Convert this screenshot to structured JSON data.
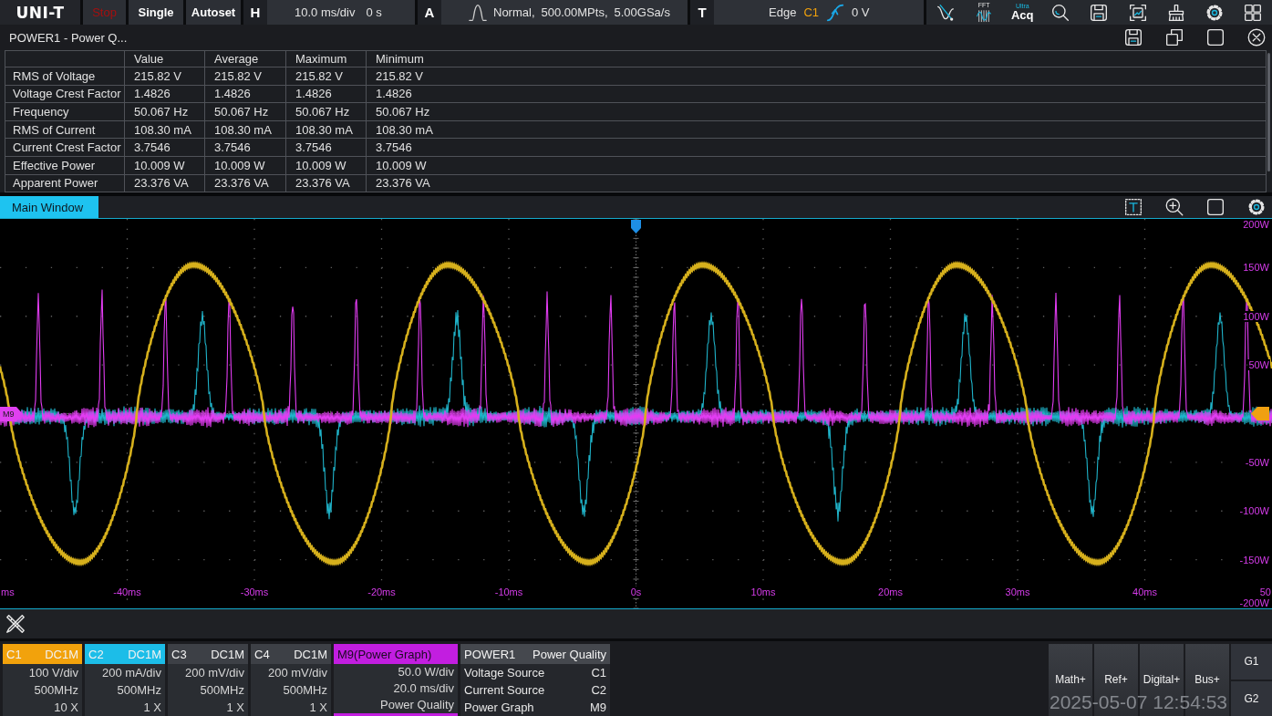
{
  "toolbar": {
    "logo": "UNI-T",
    "buttons": [
      {
        "label": "Stop",
        "kind": "run"
      },
      {
        "label": "Single",
        "kind": "action"
      },
      {
        "label": "Autoset",
        "kind": "action"
      }
    ],
    "horizontal": {
      "tag": "H",
      "scale": "10.0 ms/div",
      "offset": "0 s"
    },
    "acquisition": {
      "tag": "A",
      "mode": "Normal,",
      "depth": "500.00MPts,",
      "rate": "5.00GSa/s"
    },
    "trigger": {
      "tag": "T",
      "type": "Edge",
      "source": "C1",
      "level": "0 V"
    },
    "tools": [
      {
        "kind": "math"
      },
      {
        "kind": "fft",
        "badge": "FFT"
      },
      {
        "kind": "acq",
        "label": "Acq",
        "badge": "Ultra"
      },
      {
        "kind": "search"
      },
      {
        "kind": "save"
      },
      {
        "kind": "screenshot"
      },
      {
        "kind": "clear"
      },
      {
        "kind": "settings"
      },
      {
        "kind": "windows"
      }
    ]
  },
  "measure_window": {
    "title": "POWER1 - Power Q...",
    "tools": [
      {
        "kind": "save"
      },
      {
        "kind": "float"
      },
      {
        "kind": "maximize"
      },
      {
        "kind": "close"
      }
    ],
    "table": {
      "columns": [
        "Value",
        "Average",
        "Maximum",
        "Minimum"
      ],
      "rows": [
        {
          "label": "RMS of Voltage",
          "cells": [
            "215.82 V",
            "215.82 V",
            "215.82 V",
            "215.82 V"
          ]
        },
        {
          "label": "Voltage Crest Factor",
          "cells": [
            "1.4826",
            "1.4826",
            "1.4826",
            "1.4826"
          ]
        },
        {
          "label": "Frequency",
          "cells": [
            "50.067 Hz",
            "50.067 Hz",
            "50.067 Hz",
            "50.067 Hz"
          ]
        },
        {
          "label": "RMS of Current",
          "cells": [
            "108.30 mA",
            "108.30 mA",
            "108.30 mA",
            "108.30 mA"
          ]
        },
        {
          "label": "Current Crest Factor",
          "cells": [
            "3.7546",
            "3.7546",
            "3.7546",
            "3.7546"
          ]
        },
        {
          "label": "Effective Power",
          "cells": [
            "10.009 W",
            "10.009 W",
            "10.009 W",
            "10.009 W"
          ]
        },
        {
          "label": "Apparent Power",
          "cells": [
            "23.376 VA",
            "23.376 VA",
            "23.376 VA",
            "23.376 VA"
          ]
        }
      ]
    }
  },
  "main_window": {
    "tabs": [
      {
        "label": "Main Window",
        "selected": true
      }
    ],
    "tools": [
      {
        "kind": "text"
      },
      {
        "kind": "zoom"
      },
      {
        "kind": "maximize"
      },
      {
        "kind": "settings"
      }
    ],
    "math_marker": "M9",
    "x_labels": [
      "ms",
      "-40ms",
      "-30ms",
      "-20ms",
      "-10ms",
      "0s",
      "10ms",
      "20ms",
      "30ms",
      "40ms",
      "50"
    ],
    "y_labels": [
      "200W",
      "150W",
      "100W",
      "50W",
      "-50W",
      "-100W",
      "-150W",
      "-200W"
    ]
  },
  "channels": [
    {
      "name": "C1",
      "coupling": "DC1M",
      "color": "#f2a20c",
      "lines": [
        "100 V/div",
        "500MHz",
        "10 X"
      ]
    },
    {
      "name": "C2",
      "coupling": "DC1M",
      "color": "#1cbde8",
      "lines": [
        "200 mA/div",
        "500MHz",
        "1 X"
      ]
    },
    {
      "name": "C3",
      "coupling": "DC1M",
      "lines": [
        "200 mV/div",
        "500MHz",
        "1 X"
      ]
    },
    {
      "name": "C4",
      "coupling": "DC1M",
      "lines": [
        "200 mV/div",
        "500MHz",
        "1 X"
      ]
    }
  ],
  "math_channel": {
    "name": "M9(Power Graph)",
    "color": "#c21ee0",
    "lines": [
      "50.0 W/div",
      "20.0 ms/div",
      "Power Quality"
    ]
  },
  "power_panel": {
    "name": "POWER1",
    "type": "Power Quality",
    "rows": [
      {
        "label": "Voltage Source",
        "value": "C1"
      },
      {
        "label": "Current Source",
        "value": "C2"
      },
      {
        "label": "Power Graph",
        "value": "M9"
      }
    ]
  },
  "add_buttons": [
    "Math+",
    "Ref+",
    "Digital+",
    "Bus+"
  ],
  "groups": [
    "G1",
    "G2"
  ],
  "timestamp": "2025-05-07 12:54:53"
}
